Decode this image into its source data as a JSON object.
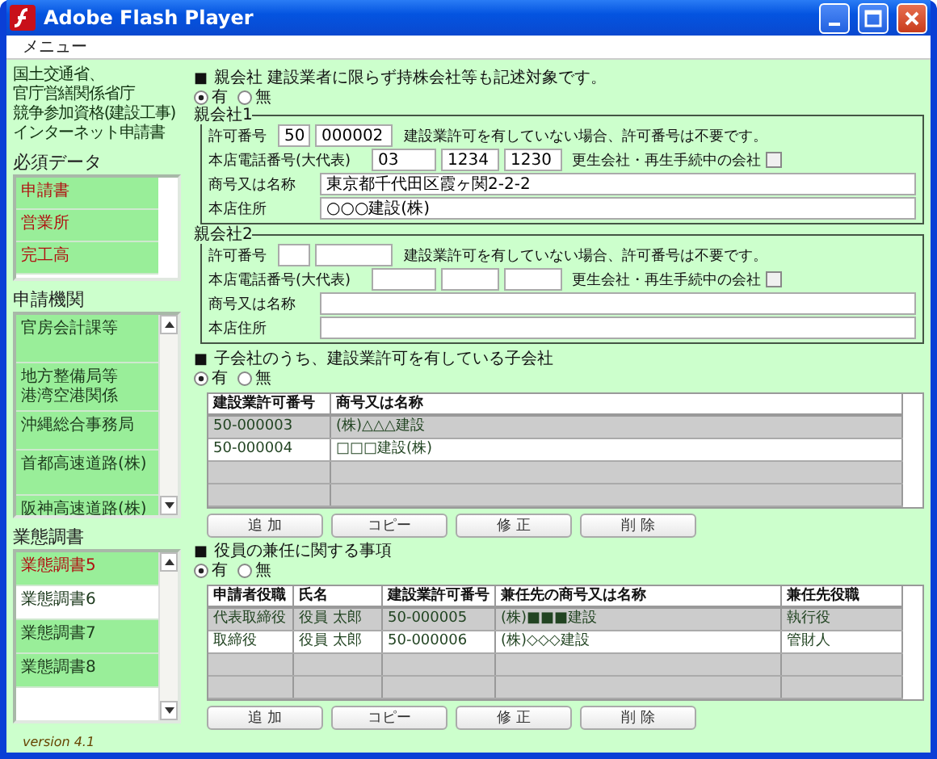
{
  "window": {
    "title": "Adobe Flash Player"
  },
  "menu": [
    "メニュー"
  ],
  "sidebar": {
    "header_lines": [
      "国土交通省、",
      "官庁営繕関係省庁",
      "競争参加資格(建設工事)",
      "インターネット申請書"
    ],
    "sections": [
      {
        "title": "必須データ",
        "scrollbar": false,
        "items": [
          {
            "label": "申請書",
            "incomplete": true,
            "selected": false
          },
          {
            "label": "営業所",
            "incomplete": true,
            "selected": false
          },
          {
            "label": "完工高",
            "incomplete": true,
            "selected": false
          }
        ]
      },
      {
        "title": "申請機関",
        "scrollbar": true,
        "items": [
          {
            "label": "官房会計課等",
            "incomplete": false,
            "selected": false
          },
          {
            "lines": [
              "地方整備局等",
              "港湾空港関係"
            ],
            "incomplete": false,
            "selected": false
          },
          {
            "label": "沖縄総合事務局",
            "incomplete": false,
            "selected": false
          },
          {
            "label": "首都高速道路(株)",
            "incomplete": false,
            "selected": false
          },
          {
            "label": "阪神高速道路(株)",
            "incomplete": false,
            "selected": false
          }
        ]
      },
      {
        "title": "業態調書",
        "scrollbar": true,
        "items": [
          {
            "label": "業態調書5",
            "incomplete": true,
            "selected": false
          },
          {
            "label": "業態調書6",
            "incomplete": false,
            "selected": true
          },
          {
            "label": "業態調書7",
            "incomplete": false,
            "selected": false
          },
          {
            "label": "業態調書8",
            "incomplete": false,
            "selected": false
          }
        ]
      }
    ],
    "version": "version 4.1"
  },
  "sections": [
    {
      "kind": "companies",
      "bullet": "■",
      "heading": "親会社 建設業者に限らず持株会社等も記述対象です。",
      "options": [
        {
          "label": "有",
          "selected": true
        },
        {
          "label": "無",
          "selected": false
        }
      ],
      "groups": [
        {
          "legend": "親会社1",
          "permit_label": "許可番号",
          "permit_prefix": "50",
          "permit_number": "000002",
          "permit_note": "建設業許可を有していない場合、許可番号は不要です。",
          "phone_label": "本店電話番号(大代表)",
          "phone": [
            "03",
            "1234",
            "1230"
          ],
          "rehab_label": "更生会社・再生手続中の会社",
          "rehab_checked": false,
          "name_label": "商号又は名称",
          "name": "東京都千代田区霞ヶ関2-2-2",
          "address_label": "本店住所",
          "address": "○○○建設(株)"
        },
        {
          "legend": "親会社2",
          "permit_label": "許可番号",
          "permit_note": "建設業許可を有していない場合、許可番号は不要です。",
          "phone_label": "本店電話番号(大代表)",
          "rehab_label": "更生会社・再生手続中の会社",
          "rehab_checked": false,
          "name_label": "商号又は名称",
          "address_label": "本店住所"
        }
      ]
    },
    {
      "kind": "table",
      "bullet": "■",
      "heading": "子会社のうち、建設業許可を有している子会社",
      "options": [
        {
          "label": "有",
          "selected": true
        },
        {
          "label": "無",
          "selected": false
        }
      ],
      "table": {
        "columns": [
          "建設業許可番号",
          "商号又は名称"
        ],
        "rows": [
          {
            "cells": [
              "50-000003",
              "(株)△△△建設"
            ],
            "selected": false
          },
          {
            "cells": [
              "50-000004",
              "□□□建設(株)"
            ],
            "selected": true
          }
        ]
      },
      "buttons": [
        "追 加",
        "コピー",
        "修 正",
        "削 除"
      ]
    },
    {
      "kind": "table",
      "bullet": "■",
      "heading": "役員の兼任に関する事項",
      "options": [
        {
          "label": "有",
          "selected": true
        },
        {
          "label": "無",
          "selected": false
        }
      ],
      "table": {
        "columns": [
          "申請者役職",
          "氏名",
          "建設業許可番号",
          "兼任先の商号又は名称",
          "兼任先役職"
        ],
        "rows": [
          {
            "cells": [
              "代表取締役",
              "役員 太郎",
              "50-000005",
              "(株)■■■建設",
              "執行役"
            ],
            "selected": false
          },
          {
            "cells": [
              "取締役",
              "役員 太郎",
              "50-000006",
              "(株)◇◇◇建設",
              "管財人"
            ],
            "selected": true
          }
        ]
      },
      "buttons": [
        "追 加",
        "コピー",
        "修 正",
        "削 除"
      ]
    }
  ]
}
